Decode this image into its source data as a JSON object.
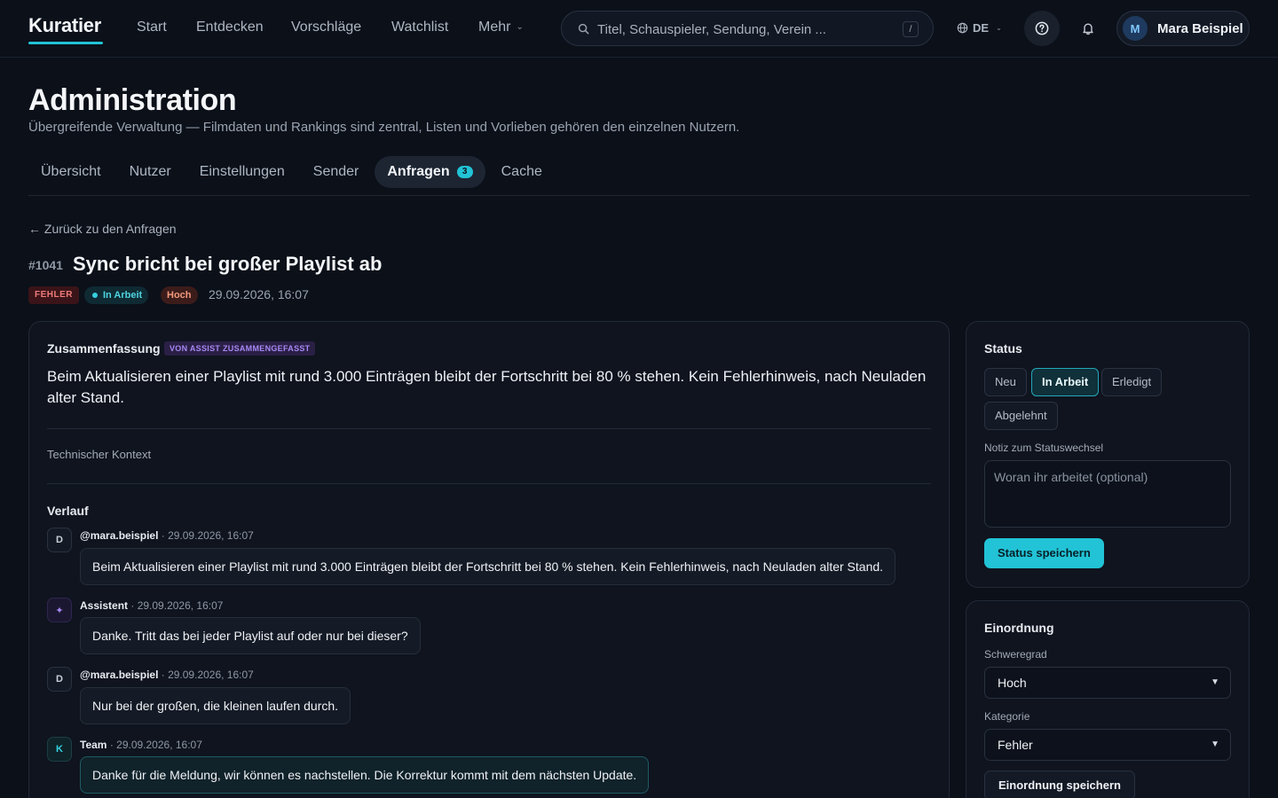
{
  "app": {
    "name": "Kuratier"
  },
  "nav": {
    "links": [
      "Start",
      "Entdecken",
      "Vorschläge",
      "Watchlist",
      "Mehr"
    ],
    "search_placeholder": "Titel, Schauspieler, Sendung, Verein ...",
    "search_shortcut": "/",
    "language": "DE",
    "user": {
      "initial": "M",
      "name": "Mara Beispiel"
    }
  },
  "page": {
    "title": "Administration",
    "subtitle": "Übergreifende Verwaltung — Filmdaten und Rankings sind zentral, Listen und Vorlieben gehören den einzelnen Nutzern.",
    "tabs": [
      {
        "label": "Übersicht"
      },
      {
        "label": "Nutzer"
      },
      {
        "label": "Einstellungen"
      },
      {
        "label": "Sender"
      },
      {
        "label": "Anfragen",
        "badge": "3",
        "active": true
      },
      {
        "label": "Cache"
      }
    ]
  },
  "request": {
    "back_link": "← Zurück zu den Anfragen",
    "id": "#1041",
    "title": "Sync bricht bei großer Playlist ab",
    "type": "FEHLER",
    "status": "In Arbeit",
    "priority": "Hoch",
    "date": "29.09.2026, 16:07",
    "summary_label": "Zusammenfassung",
    "summary_chip": "VON ASSIST ZUSAMMENGEFASST",
    "summary": "Beim Aktualisieren einer Playlist mit rund 3.000 Einträgen bleibt der Fortschritt bei 80 % stehen. Kein Fehlerhinweis, nach Neuladen alter Stand.",
    "tech_context": "Technischer Kontext",
    "history_label": "Verlauf",
    "messages": [
      {
        "avatar": "D",
        "author": "@mara.beispiel",
        "time": "· 29.09.2026, 16:07",
        "text": "Beim Aktualisieren einer Playlist mit rund 3.000 Einträgen bleibt der Fortschritt bei 80 % stehen. Kein Fehlerhinweis, nach Neuladen alter Stand."
      },
      {
        "avatar": "✦",
        "author": "Assistent",
        "time": "· 29.09.2026, 16:07",
        "text": "Danke. Tritt das bei jeder Playlist auf oder nur bei dieser?"
      },
      {
        "avatar": "D",
        "author": "@mara.beispiel",
        "time": "· 29.09.2026, 16:07",
        "text": "Nur bei der großen, die kleinen laufen durch."
      },
      {
        "avatar": "K",
        "author": "Team",
        "time": "· 29.09.2026, 16:07",
        "text": "Danke für die Meldung, wir können es nachstellen. Die Korrektur kommt mit dem nächsten Update."
      }
    ]
  },
  "sidebar": {
    "status": {
      "title": "Status",
      "options": [
        "Neu",
        "In Arbeit",
        "Erledigt",
        "Abgelehnt"
      ],
      "selected": "In Arbeit",
      "note_label": "Notiz zum Statuswechsel",
      "note_placeholder": "Woran ihr arbeitet (optional)",
      "save_label": "Status speichern"
    },
    "classification": {
      "title": "Einordnung",
      "severity_label": "Schweregrad",
      "severity_value": "Hoch",
      "category_label": "Kategorie",
      "category_value": "Fehler",
      "save_label": "Einordnung speichern"
    }
  },
  "colors": {
    "accent": "#22c3d6",
    "background": "#0b1019",
    "card": "#0f141f",
    "assist": "#a688f3",
    "error": "#f07a7a"
  }
}
